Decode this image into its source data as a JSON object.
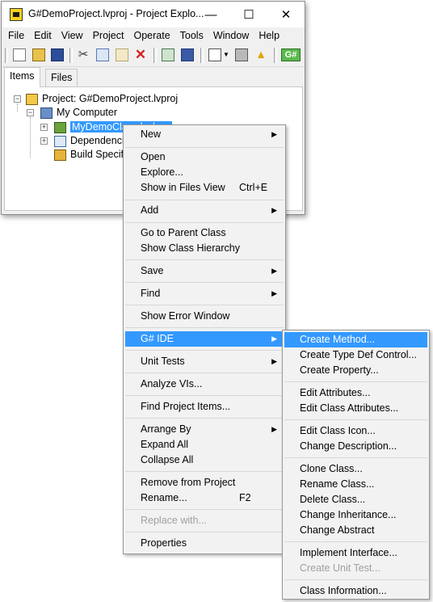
{
  "window": {
    "title": "G#DemoProject.lvproj - Project Explo...",
    "minimize": "—",
    "maximize": "☐",
    "close": "✕"
  },
  "menubar": [
    "File",
    "Edit",
    "View",
    "Project",
    "Operate",
    "Tools",
    "Window",
    "Help"
  ],
  "tabs": [
    "Items",
    "Files"
  ],
  "tree": {
    "project": "Project: G#DemoProject.lvproj",
    "computer": "My Computer",
    "class": "MyDemoClass.lvclass",
    "dependencies": "Dependencies",
    "build": "Build Specifications"
  },
  "context_menu": {
    "new": "New",
    "open": "Open",
    "explore": "Explore...",
    "show_in_files": "Show in Files View",
    "show_in_files_shortcut": "Ctrl+E",
    "add": "Add",
    "go_parent": "Go to Parent Class",
    "show_hierarchy": "Show Class Hierarchy",
    "save": "Save",
    "find": "Find",
    "show_error": "Show Error Window",
    "gsharp_ide": "G# IDE",
    "unit_tests": "Unit Tests",
    "analyze": "Analyze VIs...",
    "find_project_items": "Find Project Items...",
    "arrange_by": "Arrange By",
    "expand_all": "Expand All",
    "collapse_all": "Collapse All",
    "remove": "Remove from Project",
    "rename": "Rename...",
    "rename_shortcut": "F2",
    "replace_with": "Replace with...",
    "properties": "Properties"
  },
  "submenu": {
    "create_method": "Create Method...",
    "create_typedef": "Create Type Def Control...",
    "create_property": "Create Property...",
    "edit_attributes": "Edit Attributes...",
    "edit_class_attributes": "Edit Class Attributes...",
    "edit_class_icon": "Edit Class Icon...",
    "change_description": "Change Description...",
    "clone_class": "Clone Class...",
    "rename_class": "Rename Class...",
    "delete_class": "Delete Class...",
    "change_inheritance": "Change Inheritance...",
    "change_abstract": "Change Abstract",
    "implement_interface": "Implement Interface...",
    "create_unit_test": "Create Unit Test...",
    "class_information": "Class Information..."
  },
  "arrow_glyph": "▶"
}
